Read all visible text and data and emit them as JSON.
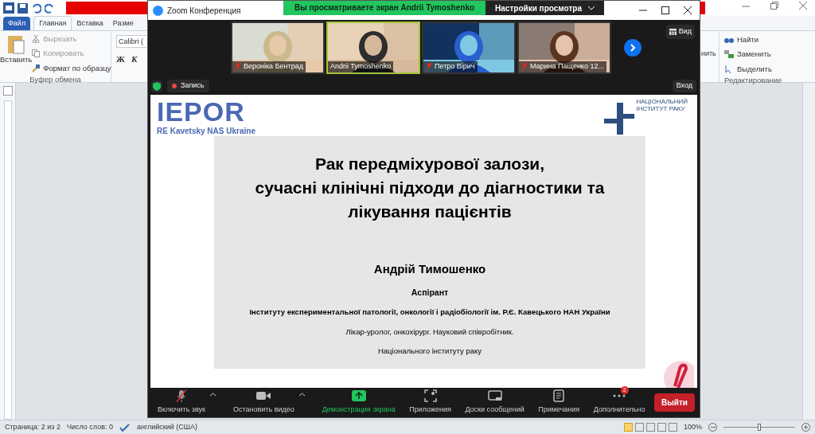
{
  "word": {
    "tabs": [
      {
        "label": "Файл",
        "kind": "file",
        "selected": false
      },
      {
        "label": "Главная",
        "kind": "tab",
        "selected": true
      },
      {
        "label": "Вставка",
        "kind": "tab",
        "selected": false
      },
      {
        "label": "Разме",
        "kind": "tab",
        "selected": false
      }
    ],
    "clipboard": {
      "paste": "Вставить",
      "cut": "Вырезать",
      "copy": "Копировать",
      "format": "Формат по образцу",
      "group": "Буфер обмена"
    },
    "font": {
      "name": "Calibri (",
      "bold": "Ж",
      "italic": "К"
    },
    "partial": "нить",
    "editing": {
      "find": "Найти",
      "replace": "Заменить",
      "select": "Выделить",
      "group": "Редактирование"
    },
    "status": {
      "page": "Страница: 2 из 2",
      "words": "Число слов: 0",
      "language": "английский (США)",
      "zoom": "100%",
      "level": 0.5
    }
  },
  "zoom": {
    "title": "Zoom Конференция",
    "banner": "Вы просматриваете экран Andrii Tymoshenko",
    "view_settings": "Настройки просмотра",
    "participants": [
      {
        "name": "Вероніка Бентрад",
        "muted": true,
        "selected": false
      },
      {
        "name": "Andrii Tymoshenko",
        "muted": false,
        "selected": true
      },
      {
        "name": "Петро Вірич",
        "muted": true,
        "selected": false
      },
      {
        "name": "Марина Пащенко 12...",
        "muted": true,
        "selected": false
      }
    ],
    "view": "Вид",
    "recording": "Запись",
    "enter": "Вход",
    "slide": {
      "logo": "IEPOR",
      "logo_sub": "RE Kavetsky NAS Ukraine",
      "institute_logo": [
        "НАЦІОНАЛЬНИЙ",
        "ІНСТИТУТ РАКУ"
      ],
      "title": [
        "Рак передміхурової залози,",
        "сучасні клінічні підходи до діагностики та",
        "лікування пацієнтів"
      ],
      "author": "Андрій Тимошенко",
      "role": "Аспірант",
      "affiliation": "Інституту експериментальної патології, онкології і радіобіології ім. Р.Є. Кавецького НАН України",
      "position": "Лікар-уролог, онкохірург. Науковий співробітник.",
      "institute": "Національного інституту раку"
    },
    "toolbar": [
      {
        "label": "Включить звук",
        "kind": "mic",
        "active": false,
        "caret": true
      },
      {
        "label": "Остановить видео",
        "kind": "video",
        "active": false,
        "caret": true
      },
      {
        "label": "Демонстрация экрана",
        "kind": "share",
        "active": true,
        "caret": false
      },
      {
        "label": "Приложения",
        "kind": "apps",
        "active": false,
        "caret": false
      },
      {
        "label": "Доски сообщений",
        "kind": "board",
        "active": false,
        "caret": false
      },
      {
        "label": "Примечания",
        "kind": "notes",
        "active": false,
        "caret": false
      },
      {
        "label": "Дополнительно",
        "kind": "more",
        "active": false,
        "caret": false,
        "badge": "2"
      }
    ],
    "leave": "Выйти"
  }
}
